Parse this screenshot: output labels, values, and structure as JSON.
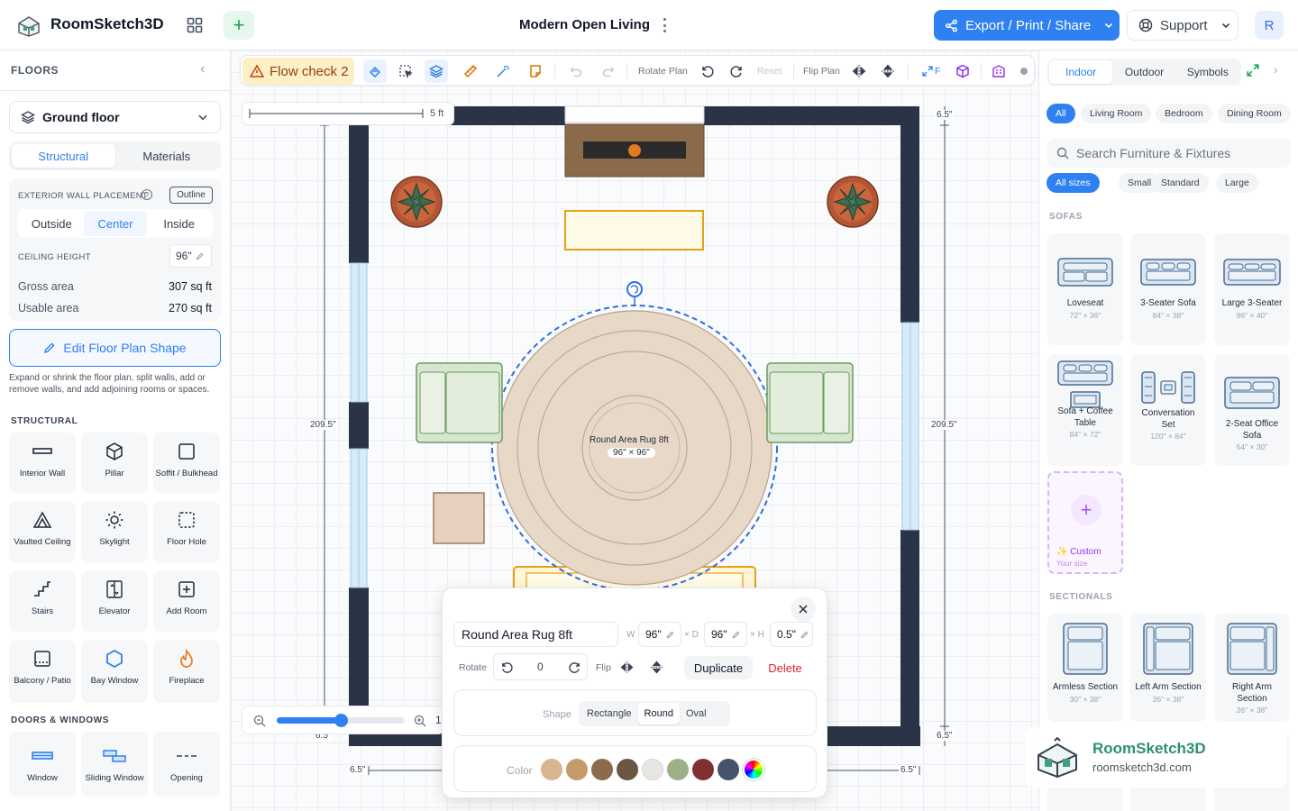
{
  "header": {
    "app_name": "RoomSketch3D",
    "project_title": "Modern Open Living",
    "export_label": "Export / Print / Share",
    "support_label": "Support",
    "avatar_initial": "R"
  },
  "left_panel": {
    "title": "FLOORS",
    "floor_select": "Ground floor",
    "tabs": [
      "Structural",
      "Materials"
    ],
    "active_tab": "Structural",
    "exterior_wall_label": "EXTERIOR WALL PLACEMENT",
    "outline_label": "Outline",
    "placement_options": [
      "Outside",
      "Center",
      "Inside"
    ],
    "placement_active": "Center",
    "ceiling_label": "CEILING HEIGHT",
    "ceiling_value": "96\"",
    "gross_label": "Gross area",
    "gross_value": "307 sq ft",
    "usable_label": "Usable area",
    "usable_value": "270 sq ft",
    "edit_shape_label": "Edit Floor Plan Shape",
    "edit_shape_desc": "Expand or shrink the floor plan, split walls, add or remove walls, and add adjoining rooms or spaces.",
    "structural_label": "STRUCTURAL",
    "structural_items": [
      "Interior Wall",
      "Pillar",
      "Soffit / Bulkhead",
      "Vaulted Ceiling",
      "Skylight",
      "Floor Hole",
      "Stairs",
      "Elevator",
      "Add Room",
      "Balcony / Patio",
      "Bay Window",
      "Fireplace"
    ],
    "doors_label": "DOORS & WINDOWS",
    "door_items": [
      "Window",
      "Sliding Window",
      "Opening"
    ]
  },
  "toolbar": {
    "flow_check": "Flow check 2",
    "rotate_plan": "Rotate Plan",
    "reset": "Reset",
    "flip_plan": "Flip Plan",
    "f_label": "F"
  },
  "canvas": {
    "scale_label": "5 ft",
    "dim_left_height": "209.5\"",
    "dim_right_height": "209.5\"",
    "dim_top_right": "6.5\"",
    "dim_bottom_right": "6.5\"",
    "dim_bottom_left_x": "6.5\"",
    "dim_bottom_right_x": "6.5\"",
    "dim_bottom_left_y": "6.5\"",
    "rug_label": "Round Area Rug 8ft",
    "rug_size": "96\" × 96\"",
    "zoom_value": "1"
  },
  "popup": {
    "name": "Round Area Rug 8ft",
    "w_label": "W",
    "w_value": "96\"",
    "d_label": "× D",
    "d_value": "96\"",
    "h_label": "× H",
    "h_value": "0.5\"",
    "rotate_label": "Rotate",
    "rotate_value": "0",
    "flip_label": "Flip",
    "duplicate_label": "Duplicate",
    "delete_label": "Delete",
    "shape_label": "Shape",
    "shape_options": [
      "Rectangle",
      "Round",
      "Oval"
    ],
    "shape_active": "Round",
    "color_label": "Color",
    "colors": [
      "#d9b48f",
      "#c49a6c",
      "#8b6b4a",
      "#6b5644",
      "#e8e6e1",
      "#9bb088",
      "#7f3131",
      "#46536a"
    ]
  },
  "right_panel": {
    "tabs": [
      "Indoor",
      "Outdoor",
      "Symbols"
    ],
    "active_tab": "Indoor",
    "rooms": [
      "All",
      "Living Room",
      "Bedroom",
      "Dining Room"
    ],
    "room_active": "All",
    "search_placeholder": "Search Furniture & Fixtures",
    "sizes": [
      "All sizes",
      "Small",
      "Standard",
      "Large"
    ],
    "size_active": "All sizes",
    "sofas_label": "SOFAS",
    "sofas": [
      {
        "name": "Loveseat",
        "size": "72\" × 36\""
      },
      {
        "name": "3-Seater Sofa",
        "size": "84\" × 38\""
      },
      {
        "name": "Large 3-Seater",
        "size": "96\" × 40\""
      },
      {
        "name": "Sofa + Coffee Table",
        "size": "84\" × 72\""
      },
      {
        "name": "Conversation Set",
        "size": "120\" × 84\""
      },
      {
        "name": "2-Seat Office Sofa",
        "size": "54\" × 30\""
      }
    ],
    "custom_label": "Custom",
    "custom_sub": "Your size",
    "sectionals_label": "SECTIONALS",
    "sectionals": [
      {
        "name": "Armless Section",
        "size": "30\" × 38\""
      },
      {
        "name": "Left Arm Section",
        "size": "36\" × 38\""
      },
      {
        "name": "Right Arm Section",
        "size": "36\" × 38\""
      }
    ]
  },
  "watermark": {
    "brand": "RoomSketch3D",
    "url": "roomsketch3d.com"
  }
}
